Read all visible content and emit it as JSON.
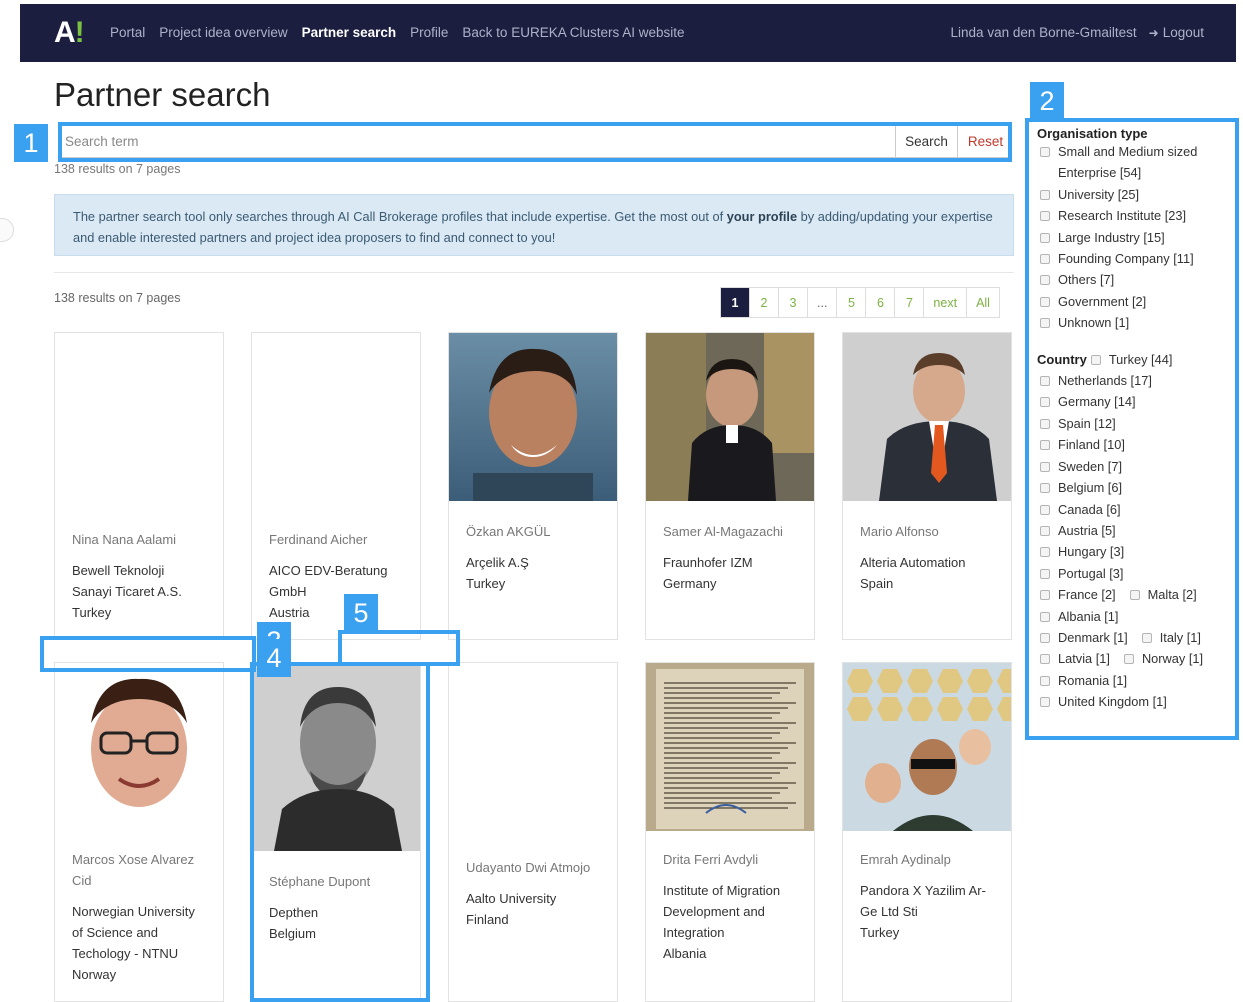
{
  "nav": {
    "logo_letter": "A",
    "logo_mark": "!",
    "links": [
      "Portal",
      "Project idea overview",
      "Partner search",
      "Profile",
      "Back to EUREKA Clusters AI website"
    ],
    "active_index": 2,
    "user": "Linda van den Borne-Gmailtest",
    "logout": "Logout",
    "logout_icon": "sign-out-icon"
  },
  "page": {
    "title": "Partner search"
  },
  "search": {
    "placeholder": "Search term",
    "value": "",
    "search_label": "Search",
    "reset_label": "Reset"
  },
  "results_summary": "138 results on 7 pages",
  "info": {
    "text_before": "The partner search tool only searches through AI Call Brokerage profiles that include expertise. Get the most out of ",
    "text_bold": "your profile",
    "text_after": " by adding/updating your expertise and enable interested partners and project idea proposers to find and connect to you!"
  },
  "pagination": [
    "1",
    "2",
    "3",
    "...",
    "5",
    "6",
    "7",
    "next",
    "All"
  ],
  "pagination_active": "1",
  "cards": [
    {
      "name": "Nina Nana Aalami",
      "org": [
        "Bewell Teknoloji",
        "Sanayi Ticaret A.S."
      ],
      "country": "Turkey",
      "photo": "none"
    },
    {
      "name": "Ferdinand Aicher",
      "org": [
        "AICO EDV-Beratung",
        "GmbH"
      ],
      "country": "Austria",
      "photo": "none"
    },
    {
      "name": "Özkan AKGÜL",
      "org": [
        "Arçelik A.Ş"
      ],
      "country": "Turkey",
      "photo": "portrait-smiling-man"
    },
    {
      "name": "Samer Al-Magazachi",
      "org": [
        "Fraunhofer IZM"
      ],
      "country": "Germany",
      "photo": "portrait-man-dark-suit"
    },
    {
      "name": "Mario Alfonso",
      "org": [
        "Alteria Automation"
      ],
      "country": "Spain",
      "photo": "portrait-man-orange-tie"
    },
    {
      "name": "Marcos Xose Alvarez Cid",
      "org": [
        "Norwegian University",
        "of Science and",
        "Techology - NTNU"
      ],
      "country": "Norway",
      "photo": "portrait-man-glasses"
    },
    {
      "name": "Stéphane Dupont",
      "org": [
        "Depthen"
      ],
      "country": "Belgium",
      "photo": "portrait-bw-man"
    },
    {
      "name": "Udayanto Dwi Atmojo",
      "org": [
        "Aalto University"
      ],
      "country": "Finland",
      "photo": "none"
    },
    {
      "name": "Drita Ferri Avdyli",
      "org": [
        "Institute of Migration",
        "Development and",
        "Integration"
      ],
      "country": "Albania",
      "photo": "document-scan"
    },
    {
      "name": "Emrah Aydinalp",
      "org": [
        "Pandora X Yazilim Ar-",
        "Ge Ltd Sti"
      ],
      "country": "Turkey",
      "photo": "family-photo"
    }
  ],
  "filters": {
    "org_title": "Organisation type",
    "org_types": [
      {
        "label": "Small and Medium sized",
        "label2": "Enterprise [54]"
      },
      {
        "label": "University [25]"
      },
      {
        "label": "Research Institute [23]"
      },
      {
        "label": "Large Industry [15]"
      },
      {
        "label": "Founding Company [11]"
      },
      {
        "label": "Others [7]"
      },
      {
        "label": "Government [2]"
      },
      {
        "label": "Unknown [1]"
      }
    ],
    "country_title": "Country",
    "country_first": "Turkey [44]",
    "countries": [
      [
        "Netherlands [17]"
      ],
      [
        "Germany [14]"
      ],
      [
        "Spain [12]"
      ],
      [
        "Finland [10]"
      ],
      [
        "Sweden [7]"
      ],
      [
        "Belgium [6]"
      ],
      [
        "Canada [6]"
      ],
      [
        "Austria [5]"
      ],
      [
        "Hungary [3]"
      ],
      [
        "Portugal [3]"
      ],
      [
        "France [2]",
        "Malta [2]"
      ],
      [
        "Albania [1]"
      ],
      [
        "Denmark [1]",
        "Italy [1]"
      ],
      [
        "Latvia [1]",
        "Norway [1]"
      ],
      [
        "Romania [1]"
      ],
      [
        "United Kingdom [1]"
      ]
    ]
  },
  "annotations": [
    "1",
    "2",
    "3",
    "4",
    "5"
  ],
  "colors": {
    "nav_bg": "#1b1e3f",
    "accent_green": "#7cb342",
    "annotation_blue": "#3aa0f0",
    "reset_red": "#c0392b"
  }
}
